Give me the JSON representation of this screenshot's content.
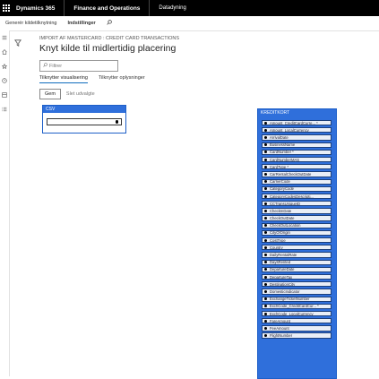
{
  "topbar": {
    "brand": "Dynamics 365",
    "app": "Finance and Operations",
    "module": "Datadyning"
  },
  "navstrip": {
    "items": [
      "Generér kildetilknytning",
      "Indstillinger"
    ]
  },
  "page": {
    "breadcrumb": "IMPORT AF MASTERCARD : CREDIT CARD TRANSACTIONS",
    "title": "Knyt kilde til midlertidig placering",
    "filter_placeholder": "Filtrer",
    "tabs": [
      "Tilknytter visualisering",
      "Tilknytter oplysninger"
    ],
    "save_label": "Gem",
    "generate_label": "Slet udvalgte"
  },
  "source": {
    "header": "CSV"
  },
  "destination": {
    "header": "KREDITKORT",
    "fields": [
      "Amount_CreditCardCurre... *",
      "Amount_LocalCurrency",
      "ArrivalDate",
      "BusinessName",
      "CardNumber *",
      "CardNumberMAS",
      "CardType *",
      "CarRentalCheckOutDate",
      "CarrierCode",
      "CategoryCode",
      "CategoryCodesDescripti...",
      "CCTransUniqueID",
      "CheckInDate",
      "CheckOutDate",
      "CheckOutLocation",
      "CityOfOrigin",
      "CostType",
      "Country",
      "DailyRentalRate",
      "DaysRented",
      "DepartureDate",
      "DepartureTax",
      "DestinationCity",
      "DomesticIndicator",
      "ExchangeTicketNumber",
      "ExchCode_CreditCardCur... *",
      "ExchCode_LocalCurrency",
      "FareAmount",
      "FeeAmount",
      "FlightNumber"
    ]
  },
  "colors": {
    "topbar": "#000000",
    "box_header": "#2f6fdb",
    "accent": "#0f6cbd"
  }
}
